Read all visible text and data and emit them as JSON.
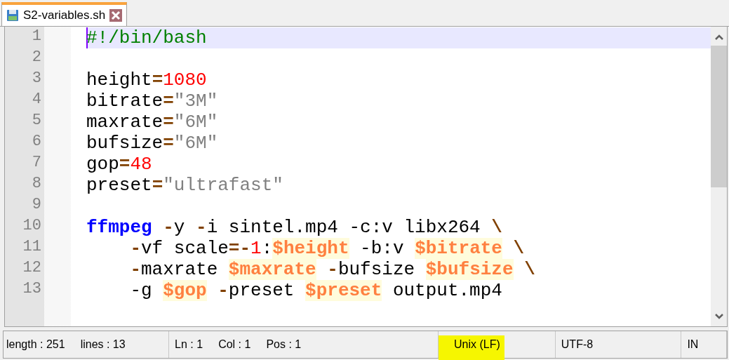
{
  "tabs": [
    {
      "label": "S2-variables.sh",
      "selected": true
    }
  ],
  "editor": {
    "lines": [
      {
        "number": "1",
        "current": true,
        "tokens": [
          {
            "kind": "comment",
            "text": "#!/bin/bash"
          }
        ]
      },
      {
        "number": "2",
        "current": false
      },
      {
        "number": "3",
        "current": false,
        "tokens": [
          {
            "kind": "plain",
            "text": "height"
          },
          {
            "kind": "op",
            "text": "="
          },
          {
            "kind": "number",
            "text": "1080"
          }
        ]
      },
      {
        "number": "4",
        "current": false,
        "tokens": [
          {
            "kind": "plain",
            "text": "bitrate"
          },
          {
            "kind": "op",
            "text": "="
          },
          {
            "kind": "string",
            "text": "\"3M\""
          }
        ]
      },
      {
        "number": "5",
        "current": false,
        "tokens": [
          {
            "kind": "plain",
            "text": "maxrate"
          },
          {
            "kind": "op",
            "text": "="
          },
          {
            "kind": "string",
            "text": "\"6M\""
          }
        ]
      },
      {
        "number": "6",
        "current": false,
        "tokens": [
          {
            "kind": "plain",
            "text": "bufsize"
          },
          {
            "kind": "op",
            "text": "="
          },
          {
            "kind": "string",
            "text": "\"6M\""
          }
        ]
      },
      {
        "number": "7",
        "current": false,
        "tokens": [
          {
            "kind": "plain",
            "text": "gop"
          },
          {
            "kind": "op",
            "text": "="
          },
          {
            "kind": "number",
            "text": "48"
          }
        ]
      },
      {
        "number": "8",
        "current": false,
        "tokens": [
          {
            "kind": "plain",
            "text": "preset"
          },
          {
            "kind": "op",
            "text": "="
          },
          {
            "kind": "string",
            "text": "\"ultrafast\""
          }
        ]
      },
      {
        "number": "9",
        "current": false
      },
      {
        "number": "10",
        "current": false,
        "tokens": [
          {
            "kind": "command",
            "text": "ffmpeg "
          },
          {
            "kind": "op",
            "text": "-"
          },
          {
            "kind": "plain",
            "text": "y "
          },
          {
            "kind": "op",
            "text": "-"
          },
          {
            "kind": "plain",
            "text": "i sintel.mp4 -c:v libx264 "
          },
          {
            "kind": "op",
            "text": "\\"
          }
        ]
      },
      {
        "number": "11",
        "current": false,
        "indent": true,
        "tokens": [
          {
            "kind": "op",
            "text": "-"
          },
          {
            "kind": "plain",
            "text": "vf scale"
          },
          {
            "kind": "op",
            "text": "=-"
          },
          {
            "kind": "number",
            "text": "1"
          },
          {
            "kind": "plain",
            "text": ":"
          },
          {
            "kind": "var",
            "text": "$height"
          },
          {
            "kind": "plain",
            "text": " -b:v "
          },
          {
            "kind": "var",
            "text": "$bitrate"
          },
          {
            "kind": "op",
            "text": " \\"
          }
        ]
      },
      {
        "number": "12",
        "current": false,
        "indent": true,
        "tokens": [
          {
            "kind": "op",
            "text": "-"
          },
          {
            "kind": "plain",
            "text": "maxrate "
          },
          {
            "kind": "var",
            "text": "$maxrate"
          },
          {
            "kind": "op",
            "text": " -"
          },
          {
            "kind": "plain",
            "text": "bufsize "
          },
          {
            "kind": "var",
            "text": "$bufsize"
          },
          {
            "kind": "op",
            "text": " \\"
          }
        ]
      },
      {
        "number": "13",
        "current": false,
        "indent": true,
        "tokens": [
          {
            "kind": "plain",
            "text": "-g "
          },
          {
            "kind": "var",
            "text": "$gop"
          },
          {
            "kind": "op",
            "text": " -"
          },
          {
            "kind": "plain",
            "text": "preset "
          },
          {
            "kind": "var",
            "text": "$preset"
          },
          {
            "kind": "plain",
            "text": " output.mp4"
          }
        ]
      }
    ]
  },
  "status_bar": [
    {
      "texts": [
        "length : 251",
        "lines : 13"
      ],
      "highlighted": false
    },
    {
      "texts": [
        "Ln : 1",
        "Col : 1",
        "Pos : 1"
      ],
      "highlighted": false
    },
    {
      "texts": [
        "Unix (LF)"
      ],
      "highlighted": true
    },
    {
      "texts": [
        "UTF-8"
      ],
      "highlighted": false
    },
    {
      "texts": [
        "IN"
      ],
      "highlighted": false
    }
  ]
}
